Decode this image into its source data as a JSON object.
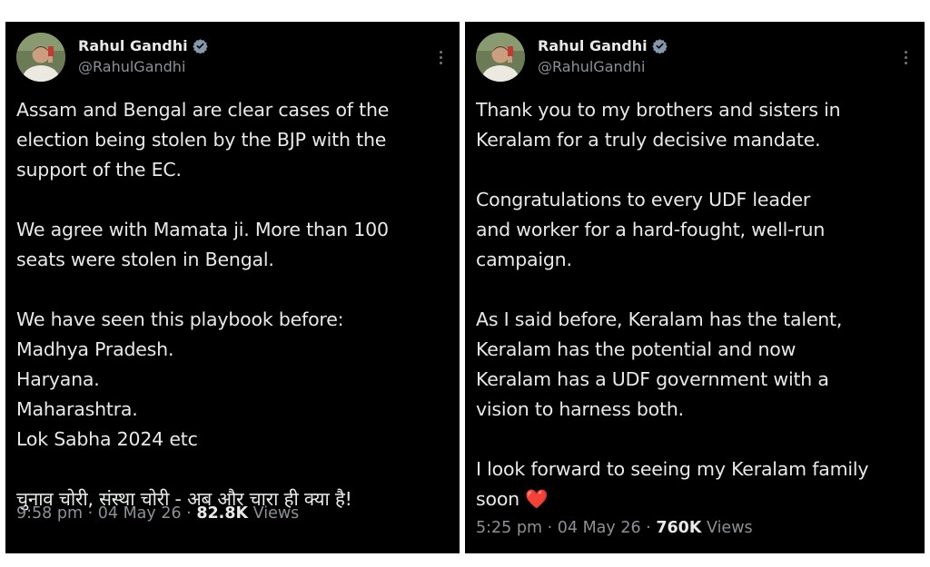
{
  "tweets": [
    {
      "author_name": "Rahul Gandhi",
      "author_handle": "@RahulGandhi",
      "lines": [
        "Assam and Bengal are clear cases of the",
        "election being stolen by the BJP with the",
        "support of the EC.",
        "",
        "We agree with Mamata ji. More than 100",
        "seats were stolen in Bengal.",
        "",
        "We have seen this playbook before:",
        "Madhya Pradesh.",
        "Haryana.",
        "Maharashtra.",
        "Lok Sabha 2024 etc",
        "",
        "चुनाव चोरी, संस्था चोरी - अब और चारा ही क्या है!"
      ],
      "time": "9:58 pm",
      "date": "04 May 26",
      "views_count": "82.8K",
      "views_label": "Views"
    },
    {
      "author_name": "Rahul Gandhi",
      "author_handle": "@RahulGandhi",
      "lines": [
        "Thank you to my brothers and sisters in",
        "Keralam for a truly decisive mandate.",
        "",
        "Congratulations to every UDF leader",
        "and worker for a hard-fought, well-run",
        "campaign.",
        "",
        "As I said before, Keralam has the talent,",
        "Keralam has the potential and now",
        "Keralam has a UDF government with a",
        "vision to harness both.",
        "",
        "I look forward to seeing my Keralam family",
        "soon"
      ],
      "end_emoji": "❤️",
      "time": "5:25 pm",
      "date": "04 May 26",
      "views_count": "760K",
      "views_label": "Views"
    }
  ],
  "colors": {
    "panel_bg": "#000000",
    "text": "#e7e9ea",
    "muted": "#8b9196",
    "verified": "#829aab",
    "heart": "#f7217f"
  }
}
